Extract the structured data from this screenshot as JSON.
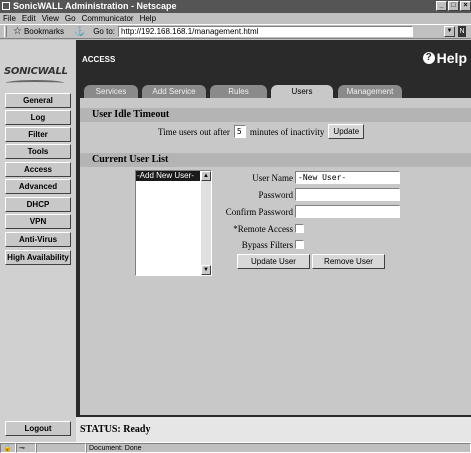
{
  "window": {
    "title": "SonicWALL Administration - Netscape",
    "buttons": [
      "_",
      "□",
      "×"
    ]
  },
  "menu": [
    "File",
    "Edit",
    "View",
    "Go",
    "Communicator",
    "Help"
  ],
  "location": {
    "bookmarks_label": "Bookmarks",
    "goto_label": "Go to:",
    "url": "http://192.168.168.1/management.html"
  },
  "brand": {
    "logo": "SONICWALL"
  },
  "nav": [
    "General",
    "Log",
    "Filter",
    "Tools",
    "Access",
    "Advanced",
    "DHCP",
    "VPN",
    "Anti-Virus",
    "High Availability"
  ],
  "logout_label": "Logout",
  "header": {
    "section": "ACCESS",
    "help_label": "Help"
  },
  "tabs": [
    "Services",
    "Add Service",
    "Rules",
    "Users",
    "Management"
  ],
  "active_tab": "Users",
  "idle": {
    "heading": "User Idle Timeout",
    "prefix": "Time users out after",
    "minutes": "5",
    "suffix": "minutes of inactivity",
    "update_label": "Update"
  },
  "users": {
    "heading": "Current User List",
    "list": [
      "-Add New User-"
    ],
    "username_label": "User Name",
    "username_value": "-New User-",
    "password_label": "Password",
    "confirm_label": "Confirm Password",
    "remote_label": "*Remote Access",
    "bypass_label": "Bypass Filters",
    "update_user_label": "Update User",
    "remove_user_label": "Remove User"
  },
  "status": {
    "text": "STATUS: Ready"
  },
  "statusbar": {
    "doc_status": "Document: Done"
  }
}
